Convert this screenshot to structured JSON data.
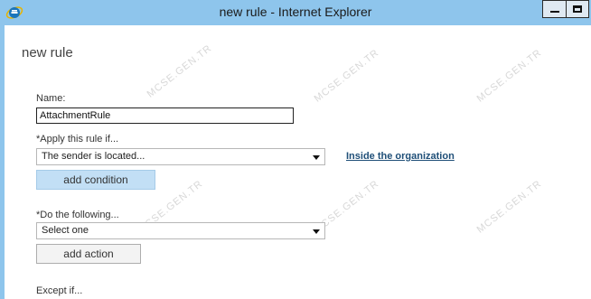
{
  "window": {
    "title": "new rule - Internet Explorer",
    "icon": "internet-explorer-icon"
  },
  "page": {
    "title": "new rule"
  },
  "form": {
    "name_label": "Name:",
    "name_value": "AttachmentRule",
    "apply_label": "*Apply this rule if...",
    "apply_selected": "The sender is located...",
    "apply_link": "Inside the organization",
    "add_condition_label": "add condition",
    "do_label": "*Do the following...",
    "do_selected": "Select one",
    "add_action_label": "add action",
    "except_label": "Except if..."
  },
  "watermark": "MCSE.GEN.TR",
  "colors": {
    "titlebar": "#8ec5ec",
    "primary_button": "#c2dff5",
    "link": "#1f4f78"
  }
}
